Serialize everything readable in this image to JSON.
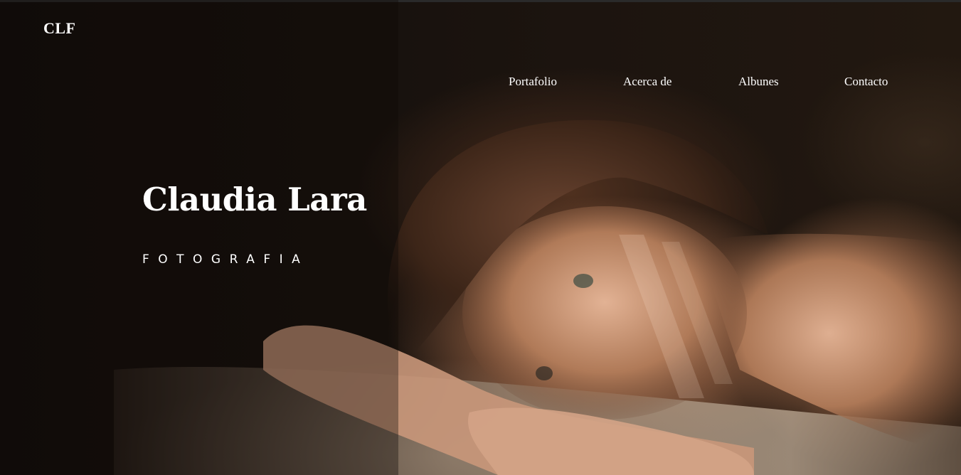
{
  "brand": {
    "logo_text": "CLF"
  },
  "nav": {
    "items": [
      {
        "label": "Portafolio"
      },
      {
        "label": "Acerca de"
      },
      {
        "label": "Albunes"
      },
      {
        "label": "Contacto"
      }
    ]
  },
  "hero": {
    "title": "Claudia Lara",
    "subtitle": "FOTOGRAFIA",
    "background_image": "woman-resting-head-on-arms-in-sunlight"
  },
  "colors": {
    "text": "#ffffff",
    "background": "#120d0b"
  }
}
